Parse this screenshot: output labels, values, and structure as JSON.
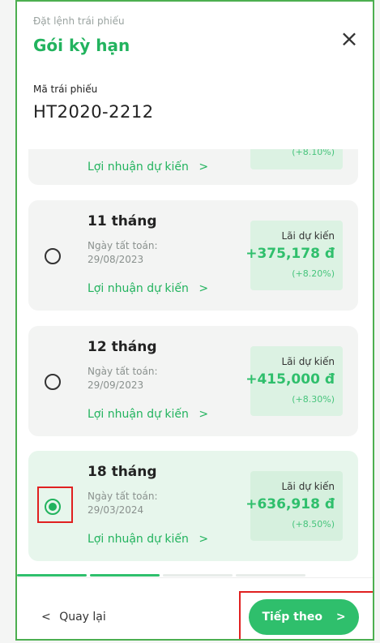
{
  "header": {
    "supertitle": "Đặt lệnh trái phiếu",
    "title": "Gói kỳ hạn",
    "close_icon": "close-icon"
  },
  "bond": {
    "code_label": "Mã trái phiếu",
    "code_value": "HT2020-2212"
  },
  "partial_card": {
    "profit_rate": "(+8.10%)",
    "link_label": "Lợi nhuận dự kiến",
    "link_chevron": ">"
  },
  "packages": [
    {
      "term": "11 tháng",
      "maturity_label": "Ngày tất toán:",
      "maturity_date": "29/08/2023",
      "profit_label": "Lãi dự kiến",
      "profit_value": "+375,178 đ",
      "profit_rate": "(+8.20%)",
      "link_label": "Lợi nhuận dự kiến",
      "link_chevron": ">",
      "selected": false
    },
    {
      "term": "12 tháng",
      "maturity_label": "Ngày tất toán:",
      "maturity_date": "29/09/2023",
      "profit_label": "Lãi dự kiến",
      "profit_value": "+415,000 đ",
      "profit_rate": "(+8.30%)",
      "link_label": "Lợi nhuận dự kiến",
      "link_chevron": ">",
      "selected": false
    },
    {
      "term": "18 tháng",
      "maturity_label": "Ngày tất toán:",
      "maturity_date": "29/03/2024",
      "profit_label": "Lãi dự kiến",
      "profit_value": "+636,918 đ",
      "profit_rate": "(+8.50%)",
      "link_label": "Lợi nhuận dự kiến",
      "link_chevron": ">",
      "selected": true
    }
  ],
  "footer": {
    "back_label": "Quay lại",
    "back_chevron": "<",
    "next_label": "Tiếp theo",
    "next_chevron": ">"
  },
  "colors": {
    "accent": "#22b35e",
    "button": "#2fbf6c",
    "highlight": "#e02020"
  }
}
